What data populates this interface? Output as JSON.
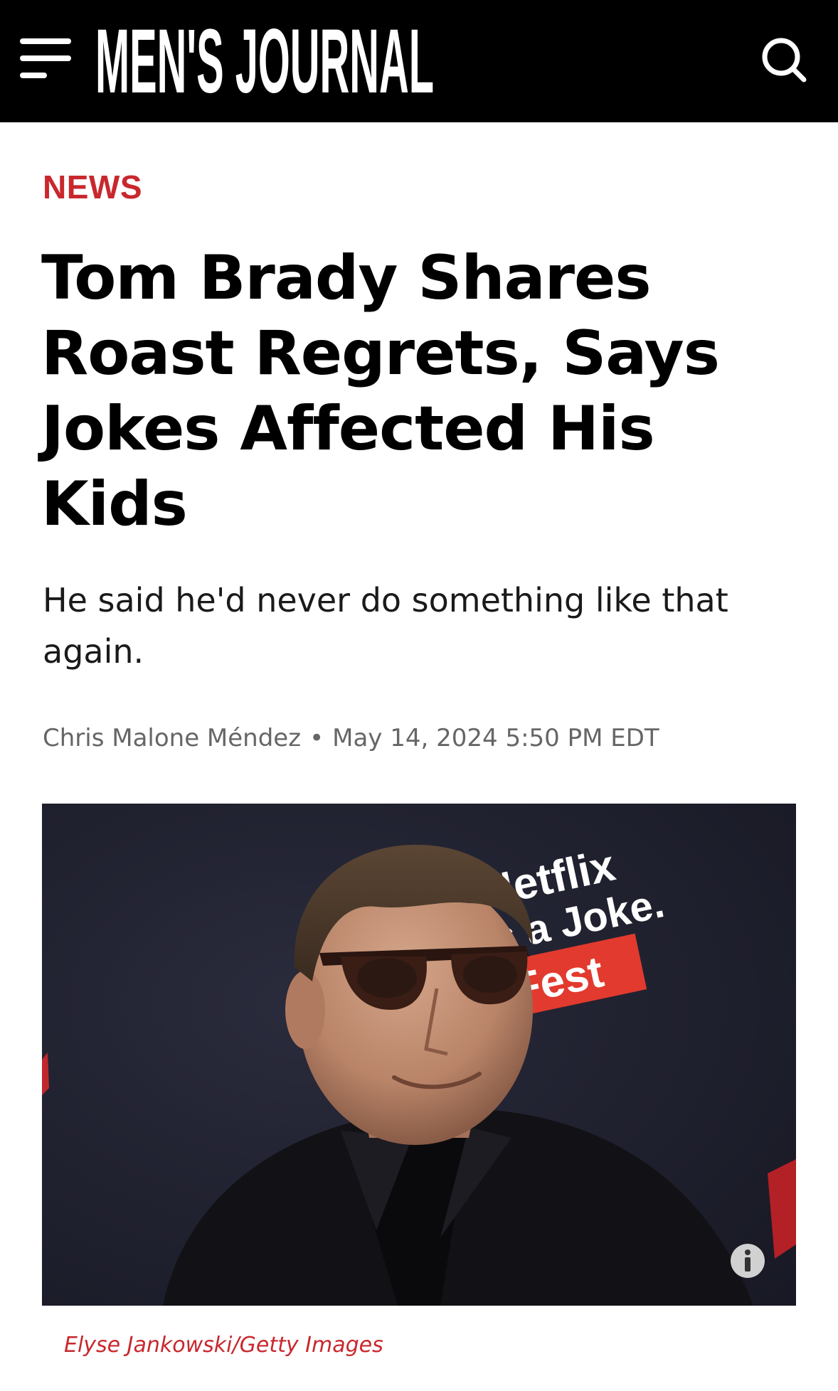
{
  "header": {
    "logo_text": "MEN'S JOURNAL",
    "menu_icon": "hamburger-menu-icon",
    "search_icon": "search-icon",
    "background": "#000000"
  },
  "article": {
    "category": "NEWS",
    "headline": "Tom Brady Shares Roast Regrets, Says Jokes Affected His Kids",
    "dek": "He said he'd never do something like that again.",
    "author": "Chris Malone Méndez",
    "separator": "•",
    "date": "May 14, 2024 5:50 PM EDT",
    "image": {
      "backdrop_text_line1": "Netflix",
      "backdrop_text_line2": "is a Joke.",
      "backdrop_text_line3": "Fest",
      "info_icon": "info-icon",
      "credit": "Elyse Jankowski/Getty Images"
    }
  },
  "colors": {
    "accent": "#c8282d",
    "text": "#000000",
    "muted": "#666666"
  }
}
